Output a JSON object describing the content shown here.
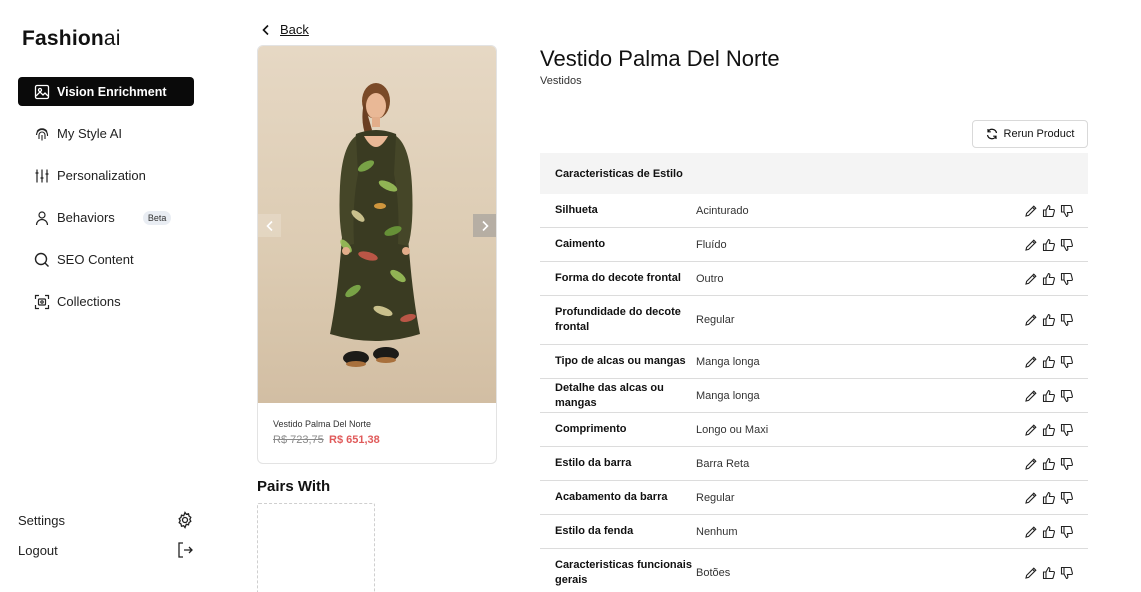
{
  "logo": {
    "main": "Fashion",
    "accent": "ai"
  },
  "sidebar": {
    "items": [
      {
        "label": "Vision Enrichment",
        "icon": "image-icon",
        "active": true
      },
      {
        "label": "My Style AI",
        "icon": "fingerprint-icon",
        "active": false
      },
      {
        "label": "Personalization",
        "icon": "sliders-icon",
        "active": false
      },
      {
        "label": "Behaviors",
        "icon": "user-icon",
        "active": false,
        "badge": "Beta"
      },
      {
        "label": "SEO Content",
        "icon": "search-icon",
        "active": false
      },
      {
        "label": "Collections",
        "icon": "scan-icon",
        "active": false
      }
    ],
    "settings_label": "Settings",
    "logout_label": "Logout"
  },
  "back_label": "Back",
  "product": {
    "name": "Vestido Palma Del Norte",
    "category": "Vestidos",
    "price_old": "R$ 723,75",
    "price_new": "R$ 651,38"
  },
  "pairs_with_title": "Pairs With",
  "rerun_label": "Rerun Product",
  "table": {
    "header": "Caracteristicas de Estilo",
    "rows": [
      {
        "attribute": "Silhueta",
        "value": "Acinturado"
      },
      {
        "attribute": "Caimento",
        "value": "Fluído"
      },
      {
        "attribute": "Forma do decote frontal",
        "value": "Outro"
      },
      {
        "attribute": "Profundidade do decote frontal",
        "value": "Regular"
      },
      {
        "attribute": "Tipo de alcas ou mangas",
        "value": "Manga longa"
      },
      {
        "attribute": "Detalhe das alcas ou mangas",
        "value": "Manga longa"
      },
      {
        "attribute": "Comprimento",
        "value": "Longo ou Maxi"
      },
      {
        "attribute": "Estilo da barra",
        "value": "Barra Reta"
      },
      {
        "attribute": "Acabamento da barra",
        "value": "Regular"
      },
      {
        "attribute": "Estilo da fenda",
        "value": "Nenhum"
      },
      {
        "attribute": "Caracteristicas funcionais gerais",
        "value": "Botões"
      }
    ]
  },
  "colors": {
    "accent": "#0a0a0a",
    "sale_price": "#e05a5a",
    "table_header_bg": "#f4f4f4"
  }
}
